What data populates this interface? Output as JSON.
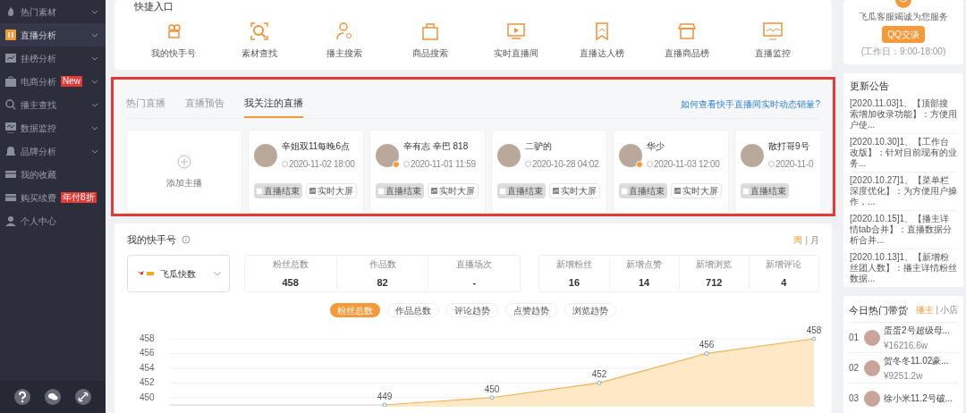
{
  "sidebar": {
    "items": [
      {
        "label": "热门素材",
        "expandable": true,
        "selected": false
      },
      {
        "label": "直播分析",
        "expandable": true,
        "selected": true
      },
      {
        "label": "挂榜分析",
        "expandable": true,
        "selected": false
      },
      {
        "label": "电商分析",
        "expandable": true,
        "selected": false,
        "badge": "New"
      },
      {
        "label": "播主查找",
        "expandable": true,
        "selected": false
      },
      {
        "label": "数据监控",
        "expandable": true,
        "selected": false
      },
      {
        "label": "品牌分析",
        "expandable": true,
        "selected": false
      },
      {
        "label": "我的收藏",
        "expandable": false,
        "selected": false
      },
      {
        "label": "购买续费",
        "expandable": false,
        "selected": false,
        "badge": "年付8折"
      },
      {
        "label": "个人中心",
        "expandable": false,
        "selected": false
      }
    ]
  },
  "quick_entry": {
    "title": "快捷入口",
    "items": [
      {
        "label": "我的快手号"
      },
      {
        "label": "素材查找"
      },
      {
        "label": "播主搜索"
      },
      {
        "label": "商品搜索"
      },
      {
        "label": "实时直播间"
      },
      {
        "label": "直播达人榜"
      },
      {
        "label": "直播商品榜"
      },
      {
        "label": "直播监控"
      }
    ]
  },
  "live": {
    "tabs": [
      {
        "label": "热门直播",
        "selected": false
      },
      {
        "label": "直播预告",
        "selected": false
      },
      {
        "label": "我关注的直播",
        "selected": true
      }
    ],
    "help_link": "如何查看快手直播间实时动态销量?",
    "add_label": "添加主播",
    "streamers": [
      {
        "name": "辛姐双11每晚6点",
        "time": "2020-11-02 18:00",
        "verified": false,
        "end_label": "直播结束",
        "screen_label": "实时大屏"
      },
      {
        "name": "辛有志 辛巴 818",
        "time": "2020-11-01 11:59",
        "verified": true,
        "end_label": "直播结束",
        "screen_label": "实时大屏"
      },
      {
        "name": "二驴的",
        "time": "2020-10-28 04:02",
        "verified": false,
        "end_label": "直播结束",
        "screen_label": "实时大屏"
      },
      {
        "name": "华少",
        "time": "2020-11-03 12:00",
        "verified": true,
        "end_label": "直播结束",
        "screen_label": "实时大屏"
      },
      {
        "name": "散打哥9号",
        "time": "2020-11-0",
        "verified": false,
        "end_label": "直播结束"
      }
    ]
  },
  "account": {
    "title": "我的快手号",
    "periods": [
      {
        "label": "周",
        "selected": true
      },
      {
        "label": "月",
        "selected": false
      }
    ],
    "period_separator": "|",
    "selector": "飞瓜快数",
    "totals": [
      {
        "label": "粉丝总数",
        "value": "458"
      },
      {
        "label": "作品数",
        "value": "82"
      },
      {
        "label": "直播场次",
        "value": "-"
      }
    ],
    "increments": [
      {
        "label": "新增粉丝",
        "value": "16"
      },
      {
        "label": "新增点赞",
        "value": "14"
      },
      {
        "label": "新增浏览",
        "value": "712"
      },
      {
        "label": "新增评论",
        "value": "4"
      }
    ],
    "chart_tabs": [
      {
        "label": "粉丝总数",
        "selected": true
      },
      {
        "label": "作品总数",
        "selected": false
      },
      {
        "label": "评论趋势",
        "selected": false
      },
      {
        "label": "点赞趋势",
        "selected": false
      },
      {
        "label": "浏览趋势",
        "selected": false
      }
    ],
    "chart_data": {
      "type": "area",
      "ylim": [
        449,
        458
      ],
      "yticks": [
        450,
        452,
        454,
        456,
        458
      ],
      "grid": true,
      "data_labels": true,
      "series": [
        {
          "color": "#f0b35a",
          "values": [
            null,
            null,
            449,
            450,
            452,
            456,
            458
          ]
        }
      ]
    }
  },
  "service": {
    "text": "飞瓜客服竭诚为您服务",
    "button": "QQ交谈",
    "hours": "(工作日：9:00-18:00)"
  },
  "notices": {
    "title": "更新公告",
    "items": [
      "[2020.11.03]1、【顶部搜索增加收录功能】：方便用户使...",
      "[2020.10.30]1、【工作台改版】：针对目前现有的业务...",
      "[2020.10.27]1、【菜单栏深度优化】：为方便用户操作，...",
      "[2020.10.15]1、【播主详情tab合并】：直播数据分析合并...",
      "[2020.10.13]1、【新增粉丝团人数】：播主详情粉丝数据..."
    ]
  },
  "hot_goods": {
    "title": "今日热门带货",
    "toggle": [
      {
        "label": "播主",
        "selected": true
      },
      {
        "label": "小店",
        "selected": false
      }
    ],
    "toggle_separator": "|",
    "items": [
      {
        "rank": "01",
        "name": "蛋蛋2号超级母...",
        "amount": "¥16216.6w"
      },
      {
        "rank": "02",
        "name": "贺冬冬11.02豪...",
        "amount": "¥9251.2w"
      },
      {
        "rank": "03",
        "name": "徐小米11.2号破..."
      }
    ]
  }
}
